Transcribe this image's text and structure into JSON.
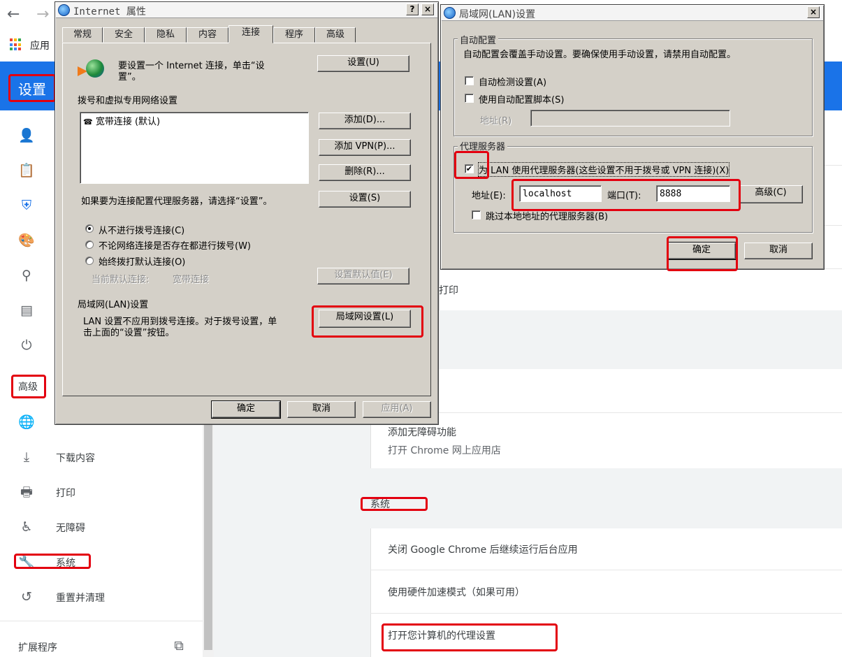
{
  "chrome": {
    "back_icon": "arrow-left-icon",
    "forward_icon": "arrow-right-icon",
    "apps_label": "应用",
    "settings_title": "设置"
  },
  "sidebar": {
    "advanced_label": "高级",
    "items": [
      {
        "icon": "person-icon",
        "label": ""
      },
      {
        "icon": "clipboard-icon",
        "label": ""
      },
      {
        "icon": "shield-icon",
        "label": ""
      },
      {
        "icon": "palette-icon",
        "label": ""
      },
      {
        "icon": "search-icon",
        "label": ""
      },
      {
        "icon": "browser-icon",
        "label": ""
      },
      {
        "icon": "power-icon",
        "label": ""
      },
      {
        "icon": "globe-icon",
        "label": ""
      },
      {
        "icon": "download-icon",
        "label": "下载内容"
      },
      {
        "icon": "printer-icon",
        "label": "打印"
      },
      {
        "icon": "accessibility-icon",
        "label": "无障碍"
      },
      {
        "icon": "wrench-icon",
        "label": "系统"
      },
      {
        "icon": "restore-icon",
        "label": "重置并清理"
      }
    ],
    "extensions_label": "扩展程序"
  },
  "main": {
    "print_row": "打印",
    "accessibility": {
      "add_features": "添加无障碍功能",
      "open_store": "打开 Chrome 网上应用店"
    },
    "system_heading": "系统",
    "system_rows": [
      "关闭 Google Chrome 后继续运行后台应用",
      "使用硬件加速模式（如果可用）",
      "打开您计算机的代理设置"
    ]
  },
  "inet_dialog": {
    "title": "Internet 属性",
    "help_btn": "?",
    "close_btn": "×",
    "tabs": [
      "常规",
      "安全",
      "隐私",
      "内容",
      "连接",
      "程序",
      "高级"
    ],
    "active_tab": "连接",
    "setup_text_1": "要设置一个 Internet 连接，单击“设",
    "setup_text_2": "置”。",
    "setup_btn": "设置(U)",
    "dialup_heading": "拨号和虚拟专用网络设置",
    "connection_item": "宽带连接 (默认)",
    "add_btn": "添加(D)...",
    "add_vpn_btn": "添加 VPN(P)...",
    "remove_btn": "删除(R)...",
    "proxy_hint": "如果要为连接配置代理服务器，请选择“设置”。",
    "settings_btn": "设置(S)",
    "radio_never": "从不进行拨号连接(C)",
    "radio_when_none": "不论网络连接是否存在都进行拨号(W)",
    "radio_always": "始终拨打默认连接(O)",
    "current_default_label": "当前默认连接:",
    "current_default_value": "宽带连接",
    "set_default_btn": "设置默认值(E)",
    "lan_heading": "局域网(LAN)设置",
    "lan_text_1": "LAN 设置不应用到拨号连接。对于拨号设置，单",
    "lan_text_2": "击上面的“设置”按钮。",
    "lan_btn": "局域网设置(L)",
    "ok_btn": "确定",
    "cancel_btn": "取消",
    "apply_btn": "应用(A)"
  },
  "lan_dialog": {
    "title": "局域网(LAN)设置",
    "close_btn": "×",
    "auto_group": "自动配置",
    "auto_desc": "自动配置会覆盖手动设置。要确保使用手动设置，请禁用自动配置。",
    "auto_detect": "自动检测设置(A)",
    "auto_script": "使用自动配置脚本(S)",
    "address_label_disabled": "地址(R)",
    "proxy_group": "代理服务器",
    "use_proxy": "为 LAN 使用代理服务器(这些设置不用于拨号或 VPN 连接)(X)",
    "address_label": "地址(E):",
    "address_value": "localhost",
    "port_label": "端口(T):",
    "port_value": "8888",
    "advanced_btn": "高级(C)",
    "bypass_local": "跳过本地地址的代理服务器(B)",
    "ok_btn": "确定",
    "cancel_btn": "取消",
    "check_mark": "✔"
  }
}
